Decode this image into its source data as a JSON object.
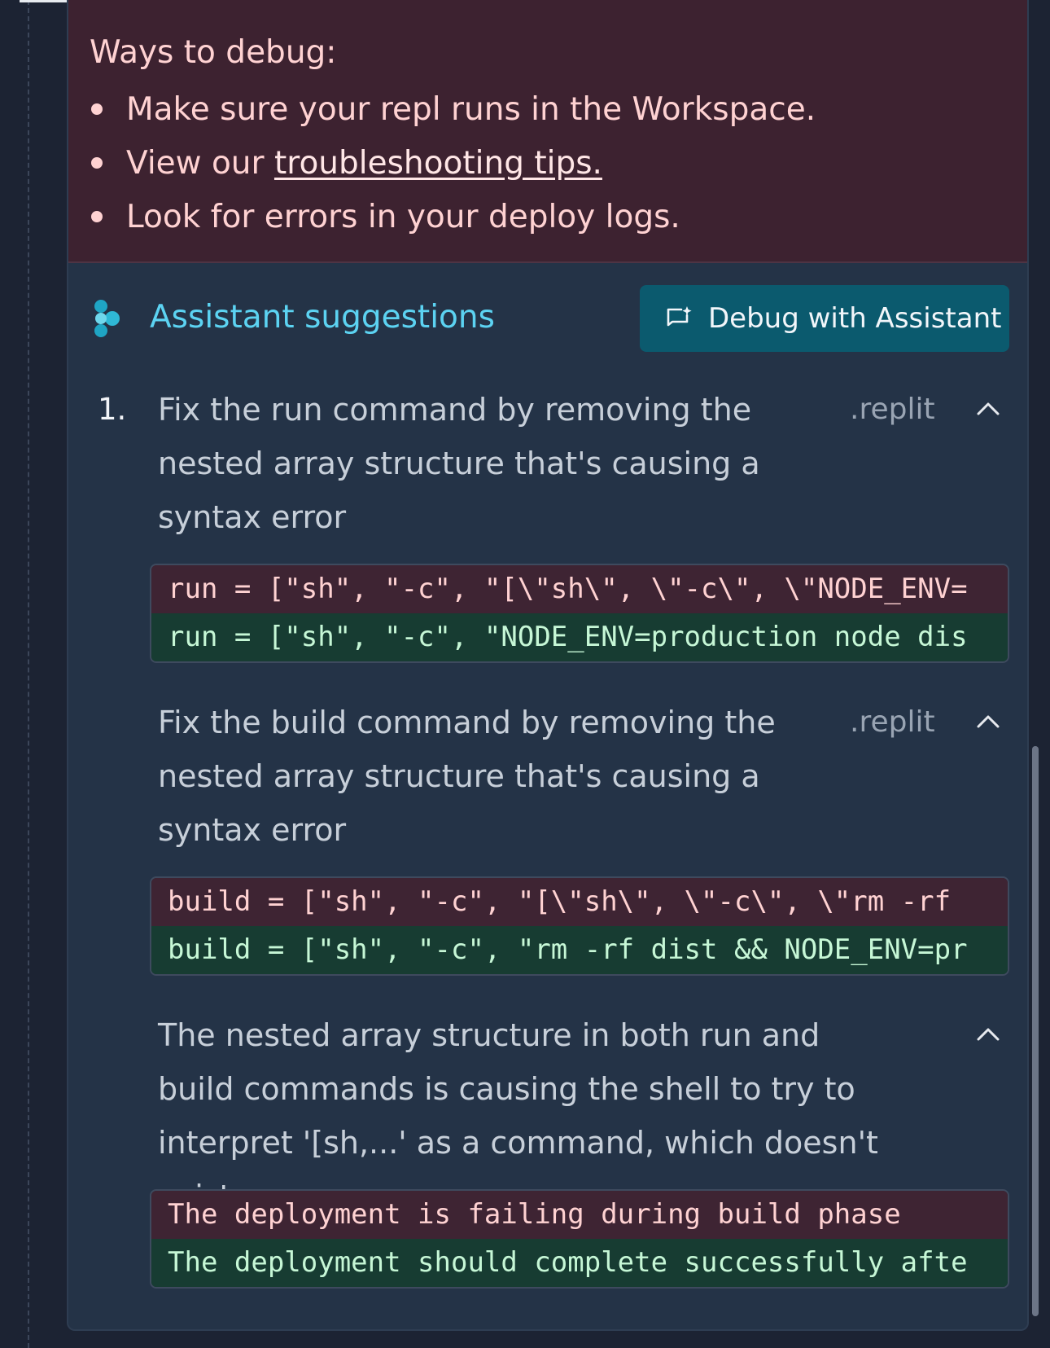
{
  "error": {
    "title": "Ways to debug:",
    "items": [
      {
        "text": "Make sure your repl runs in the Workspace."
      },
      {
        "prefix": "View our ",
        "link": "troubleshooting tips."
      },
      {
        "text": "Look for errors in your deploy logs."
      }
    ]
  },
  "assistant": {
    "title": "Assistant suggestions",
    "debug_button": "Debug with Assistant",
    "step_number": "1.",
    "suggestions": [
      {
        "description": "Fix the run command by removing the nested array structure that's causing a syntax error",
        "file": ".replit",
        "removed": "run = [\"sh\", \"-c\", \"[\\\"sh\\\", \\\"-c\\\", \\\"NODE_ENV=",
        "added": "run = [\"sh\", \"-c\", \"NODE_ENV=production node dis"
      },
      {
        "description": "Fix the build command by removing the nested array structure that's causing a syntax error",
        "file": ".replit",
        "removed": "build = [\"sh\", \"-c\", \"[\\\"sh\\\", \\\"-c\\\", \\\"rm -rf",
        "added": "build = [\"sh\", \"-c\", \"rm -rf dist && NODE_ENV=pr"
      },
      {
        "description": "The nested array structure in both run and build commands is causing the shell to try to interpret '[sh,...' as a command, which doesn't exist",
        "file": "",
        "removed": "The deployment is failing during build phase",
        "added": "The deployment should complete successfully afte"
      }
    ]
  },
  "colors": {
    "error_bg": "#3d2230",
    "card_bg": "#243347",
    "accent": "#5cd3f2",
    "button_bg": "#0b5a6e",
    "diff_removed_bg": "#3e2433",
    "diff_added_bg": "#173c32"
  },
  "icons": {
    "assistant_logo": "assistant-logo-icon",
    "debug_button_icon": "chat-sparkle-icon",
    "collapse": "chevron-up-icon"
  }
}
